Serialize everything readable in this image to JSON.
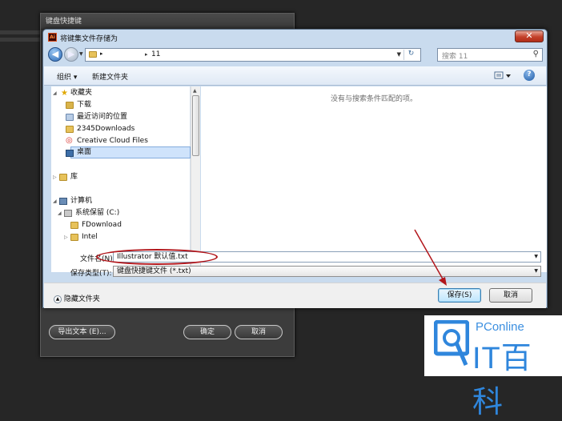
{
  "back_dialog": {
    "title": "键盘快捷键",
    "export_button": "导出文本 (E)...",
    "ok_button": "确定",
    "cancel_button": "取消"
  },
  "save_dialog": {
    "title": "将键集文件存储为",
    "address": {
      "current_folder": "11"
    },
    "search": {
      "placeholder": "搜索 11"
    },
    "toolbar": {
      "organize": "组织 ▾",
      "new_folder": "新建文件夹"
    },
    "nav": {
      "items": [
        {
          "label": "收藏夹",
          "icon": "star-icon"
        },
        {
          "label": "下载",
          "icon": "download-folder-icon"
        },
        {
          "label": "最近访问的位置",
          "icon": "recent-places-icon"
        },
        {
          "label": "2345Downloads",
          "icon": "folder-icon"
        },
        {
          "label": "Creative Cloud Files",
          "icon": "creative-cloud-icon"
        },
        {
          "label": "桌面",
          "icon": "desktop-icon",
          "selected": true
        },
        {
          "label": "库",
          "icon": "library-icon"
        },
        {
          "label": "计算机",
          "icon": "computer-icon"
        },
        {
          "label": "系统保留 (C:)",
          "icon": "drive-icon"
        },
        {
          "label": "FDownload",
          "icon": "folder-icon"
        },
        {
          "label": "Intel",
          "icon": "folder-icon"
        }
      ]
    },
    "content": {
      "empty_message": "没有与搜索条件匹配的项。"
    },
    "form": {
      "filename_label": "文件名(N):",
      "filename_value": "Illustrator 默认值.txt",
      "filetype_label": "保存类型(T):",
      "filetype_value": "键盘快捷键文件 (*.txt)"
    },
    "footer": {
      "hide_folders": "隐藏文件夹",
      "save_button": "保存(S)",
      "cancel_button": "取消"
    }
  },
  "watermark": {
    "top": "PConline",
    "main": "IT百科"
  },
  "colors": {
    "annotation": "#b2161b",
    "watermark": "#2f86dc"
  }
}
